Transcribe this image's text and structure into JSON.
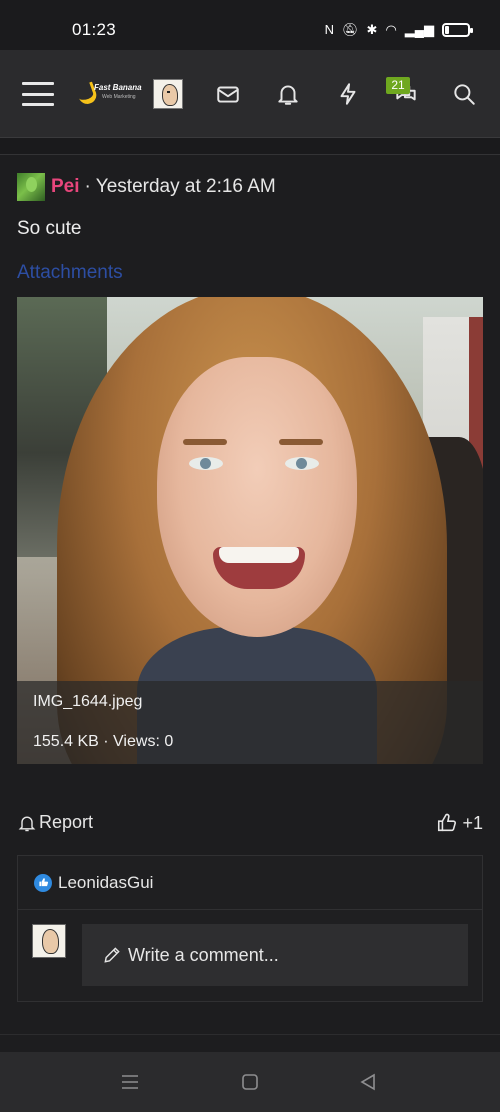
{
  "status_bar": {
    "time": "01:23",
    "icons": [
      "nfc-icon",
      "mute-icon",
      "bluetooth-icon",
      "wifi-icon",
      "signal-icon",
      "battery-icon"
    ]
  },
  "nav": {
    "logo": {
      "brand": "Fast Banana",
      "tagline": "Web Marketing"
    },
    "chat_badge": "21",
    "icons": [
      "menu-icon",
      "mail-icon",
      "bell-icon",
      "bolt-icon",
      "chat-icon",
      "search-icon"
    ]
  },
  "post": {
    "username": "Pei",
    "meta": "· Yesterday at 2:16 AM",
    "text": "So cute",
    "attachments_label": "Attachments",
    "attachment": {
      "filename": "IMG_1644.jpeg",
      "meta": "155.4 KB · Views: 0"
    },
    "report_label": "Report",
    "like_label": "+1",
    "reactor": "LeonidasGui",
    "comment_placeholder": "Write a comment..."
  },
  "colors": {
    "username": "#e8467c",
    "attachments_link": "#2d4ea3",
    "badge": "#6fa81f",
    "like_reaction": "#2f8ae0"
  }
}
